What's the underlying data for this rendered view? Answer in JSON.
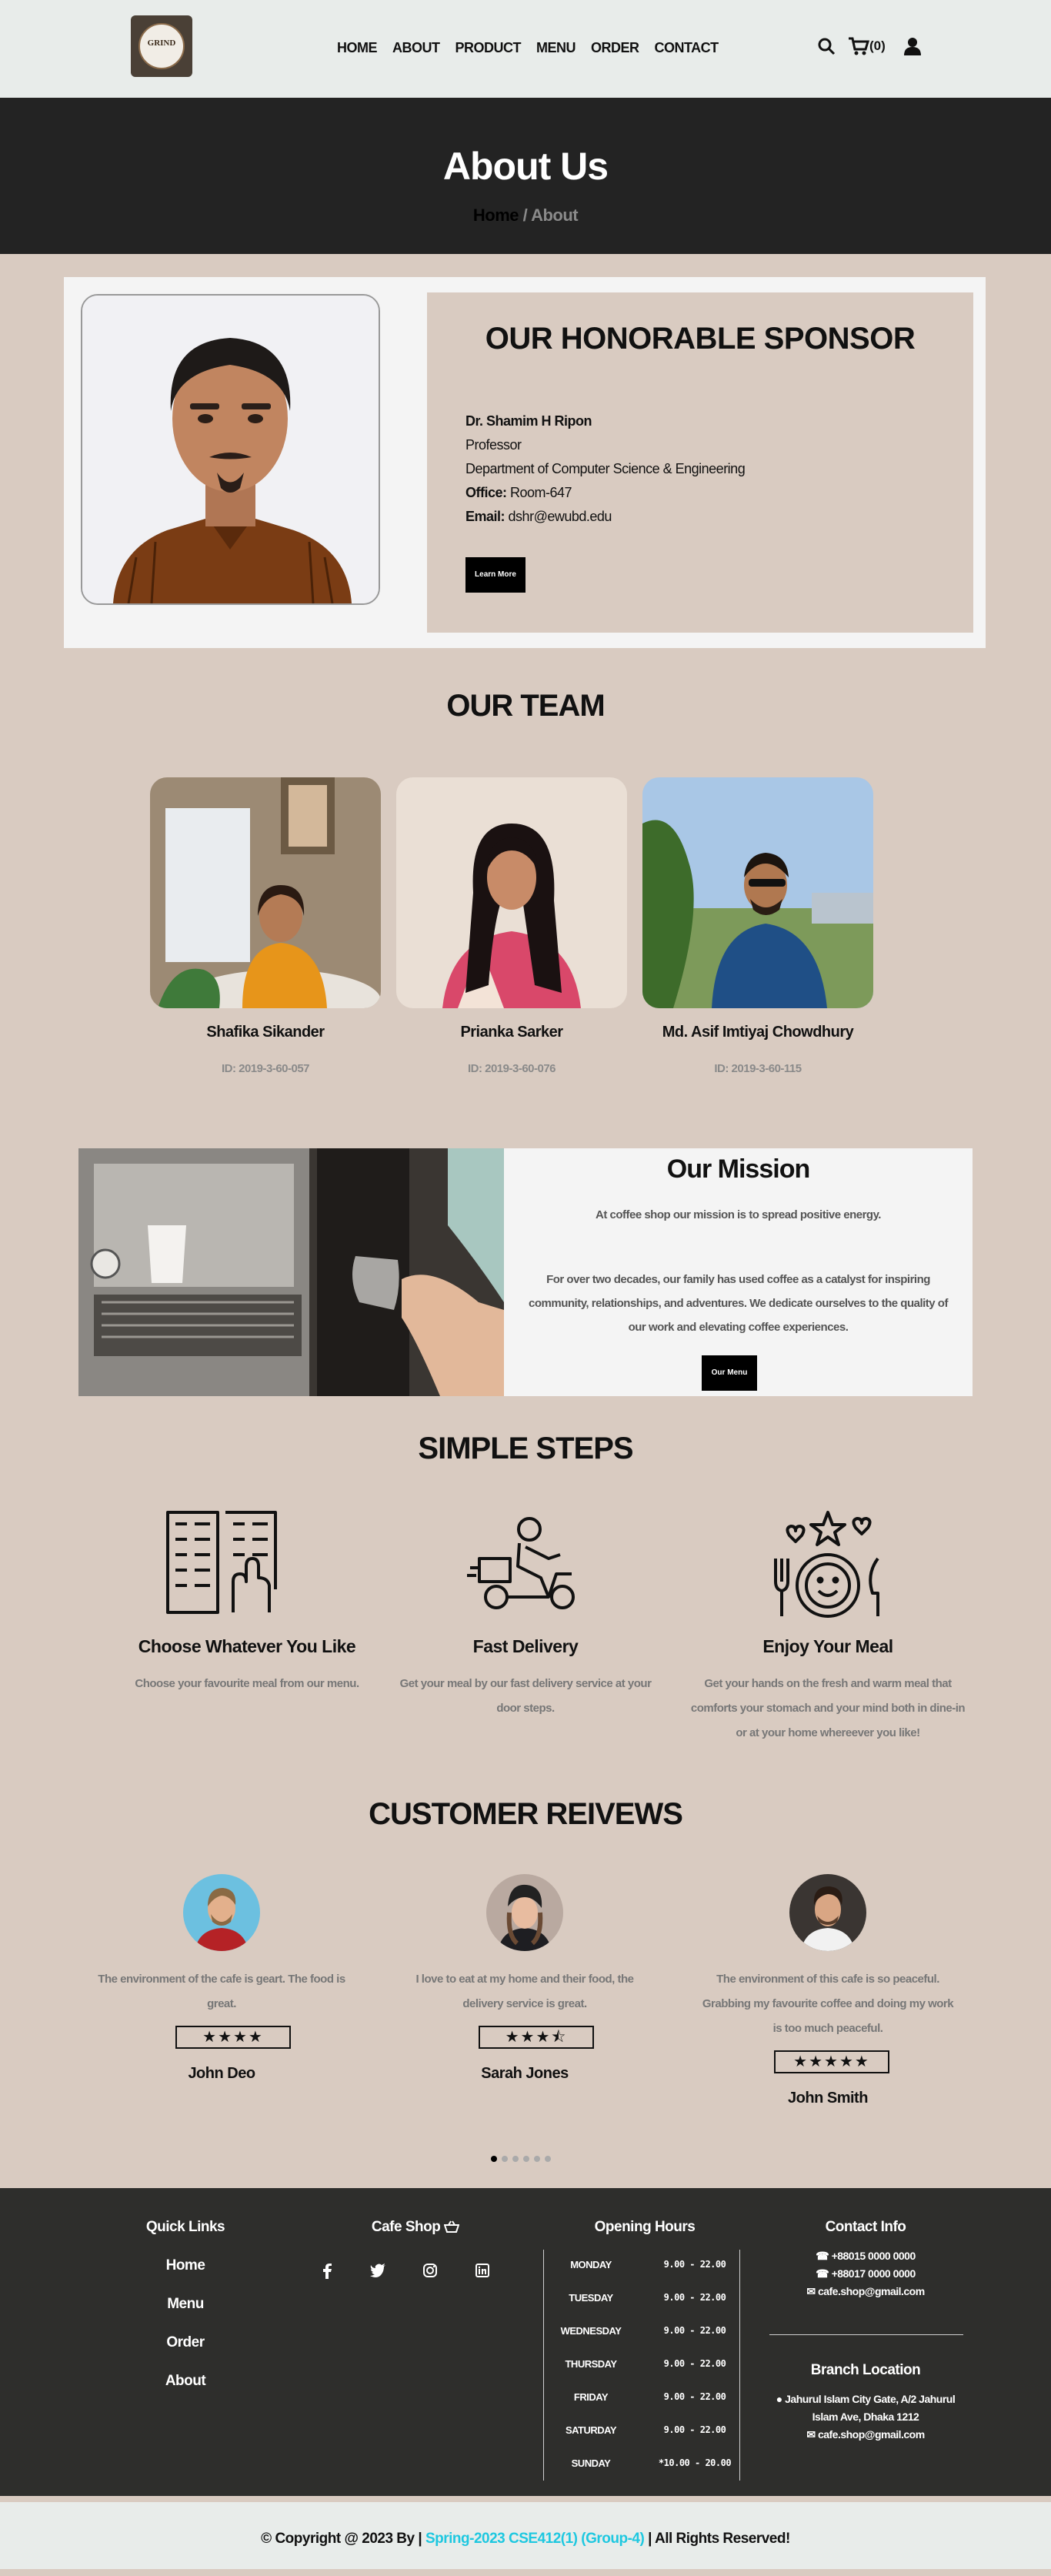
{
  "nav": {
    "logo_text": "GRIND",
    "items": [
      "HOME",
      "ABOUT",
      "PRODUCT",
      "MENU",
      "ORDER",
      "CONTACT"
    ],
    "cart_count": "(0)"
  },
  "hero": {
    "title": "About Us",
    "crumb_home": "Home",
    "crumb_sep": "/",
    "crumb_current": "About"
  },
  "sponsor": {
    "heading": "OUR HONORABLE SPONSOR",
    "name": "Dr. Shamim H Ripon",
    "role": "Professor",
    "dept": "Department of Computer Science & Engineering",
    "office_label": "Office:",
    "office": "Room-647",
    "email_label": "Email:",
    "email": "dshr@ewubd.edu",
    "button": "Learn More"
  },
  "team": {
    "heading": "OUR TEAM",
    "members": [
      {
        "name": "Shafika Sikander",
        "id": "ID: 2019-3-60-057"
      },
      {
        "name": "Prianka Sarker",
        "id": "ID: 2019-3-60-076"
      },
      {
        "name": "Md. Asif Imtiyaj Chowdhury",
        "id": "ID: 2019-3-60-115"
      }
    ]
  },
  "mission": {
    "heading": "Our Mission",
    "p1": "At coffee shop our mission is to spread positive energy.",
    "p2": "For over two decades, our family has used coffee as a catalyst for inspiring community, relationships, and adventures. We dedicate ourselves to the quality of our work and elevating coffee experiences.",
    "button": "Our Menu"
  },
  "steps": {
    "heading": "SIMPLE STEPS",
    "items": [
      {
        "title": "Choose Whatever You Like",
        "desc": "Choose your favourite meal from our menu."
      },
      {
        "title": "Fast Delivery",
        "desc": "Get your meal by our fast delivery service at your door steps."
      },
      {
        "title": "Enjoy Your Meal",
        "desc": "Get your hands on the fresh and warm meal that comforts your stomach and your mind both in dine-in or at your home whereever you like!"
      }
    ]
  },
  "reviews": {
    "heading": "CUSTOMER REIVEWS",
    "items": [
      {
        "text": "The environment of the cafe is geart. The food is great.",
        "stars": "★★★★",
        "rating": 4,
        "name": "John Deo"
      },
      {
        "text": "I love to eat at my home and their food, the delivery service is great.",
        "stars": "★★★⯪",
        "rating": 3.5,
        "name": "Sarah Jones"
      },
      {
        "text": "The environment of this cafe is so peaceful. Grabbing my favourite coffee and doing my work is too much peaceful.",
        "stars": "★★★★★",
        "rating": 5,
        "name": "John Smith"
      }
    ],
    "active_slide": 1,
    "slide_count": 6
  },
  "footer": {
    "quick_links_title": "Quick Links",
    "quick_links": [
      "Home",
      "Menu",
      "Order",
      "About"
    ],
    "cafe_title": "Cafe Shop",
    "socials": [
      "f",
      "t",
      "ig",
      "in"
    ],
    "hours_title": "Opening Hours",
    "hours": [
      {
        "day": "MONDAY",
        "time": "9.00 - 22.00"
      },
      {
        "day": "TUESDAY",
        "time": "9.00 - 22.00"
      },
      {
        "day": "WEDNESDAY",
        "time": "9.00 - 22.00"
      },
      {
        "day": "THURSDAY",
        "time": "9.00 - 22.00"
      },
      {
        "day": "FRIDAY",
        "time": "9.00 - 22.00"
      },
      {
        "day": "SATURDAY",
        "time": "9.00 - 22.00"
      },
      {
        "day": "SUNDAY",
        "time": "*10.00 - 20.00"
      }
    ],
    "contact_title": "Contact Info",
    "phone1": "+88015 0000 0000",
    "phone2": "+88017 0000 0000",
    "email1": "cafe.shop@gmail.com",
    "branch_title": "Branch Location",
    "address1": "Jahurul Islam City Gate, A/2 Jahurul",
    "address2": "Islam Ave, Dhaka 1212",
    "email2": "cafe.shop@gmail.com"
  },
  "copyright": {
    "prefix": "© Copyright @ 2023 By |",
    "group": "Spring-2023 CSE412(1) (Group-4)",
    "suffix": "| All Rights Reserved!"
  }
}
